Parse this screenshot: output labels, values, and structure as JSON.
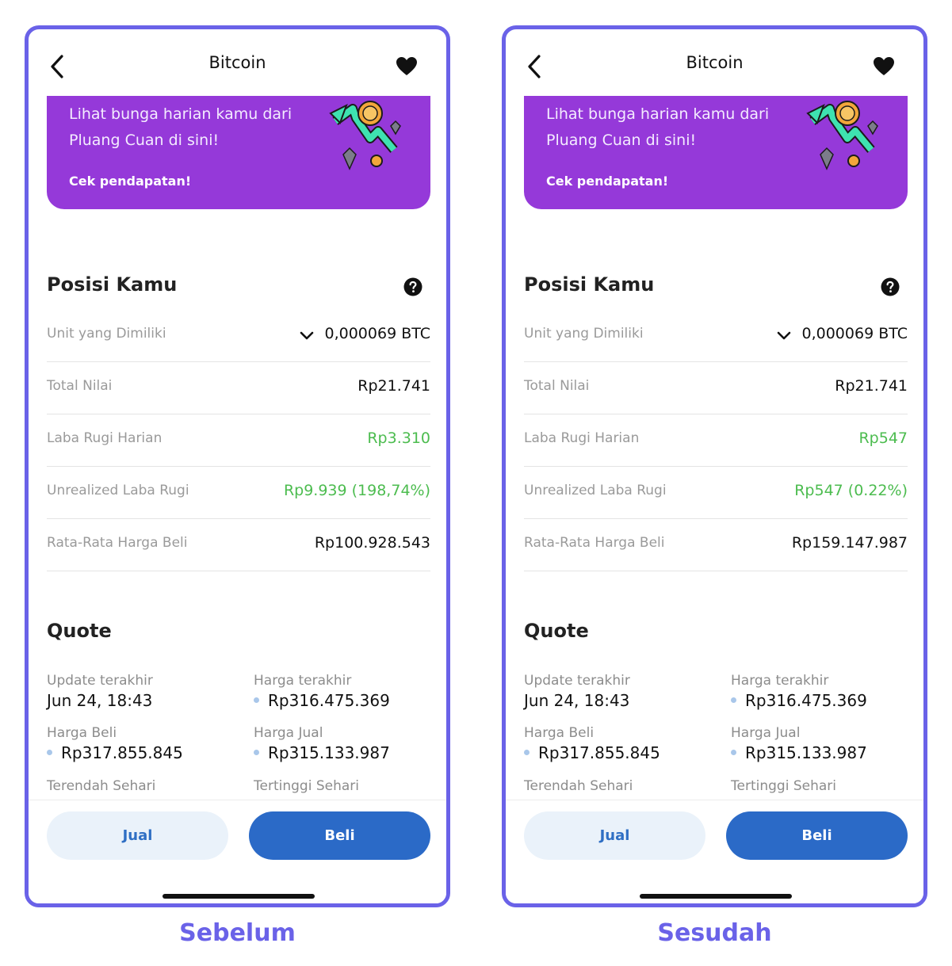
{
  "colors": {
    "frame": "#6a62e8",
    "banner": "#9539d9",
    "positive": "#4cbc4f",
    "primary": "#2b6ac7"
  },
  "panels": [
    {
      "caption": "Sebelum",
      "header": {
        "title": "Bitcoin",
        "back_icon": "chevron-left-icon",
        "fav_icon": "heart-icon"
      },
      "banner": {
        "text": "Lihat bunga harian kamu dari Pluang Cuan di sini!",
        "cta": "Cek pendapatan!"
      },
      "position": {
        "title": "Posisi Kamu",
        "rows": [
          {
            "label": "Unit yang Dimiliki",
            "value": "0,000069 BTC"
          },
          {
            "label": "Total Nilai",
            "value": "Rp21.741"
          },
          {
            "label": "Laba Rugi Harian",
            "value": "Rp3.310"
          },
          {
            "label": "Unrealized Laba Rugi",
            "value": "Rp9.939 (198,74%)"
          },
          {
            "label": "Rata-Rata Harga Beli",
            "value": "Rp100.928.543"
          }
        ]
      },
      "quote": {
        "title": "Quote",
        "update_label": "Update terakhir",
        "update_value": "Jun 24, 18:43",
        "last_label": "Harga terakhir",
        "last_value": "Rp316.475.369",
        "buy_label": "Harga Beli",
        "buy_value": "Rp317.855.845",
        "sell_label": "Harga Jual",
        "sell_value": "Rp315.133.987",
        "low_label": "Terendah Sehari",
        "high_label": "Tertinggi Sehari"
      },
      "actions": {
        "sell": "Jual",
        "buy": "Beli"
      }
    },
    {
      "caption": "Sesudah",
      "header": {
        "title": "Bitcoin",
        "back_icon": "chevron-left-icon",
        "fav_icon": "heart-icon"
      },
      "banner": {
        "text": "Lihat bunga harian kamu dari Pluang Cuan di sini!",
        "cta": "Cek pendapatan!"
      },
      "position": {
        "title": "Posisi Kamu",
        "rows": [
          {
            "label": "Unit yang Dimiliki",
            "value": "0,000069 BTC"
          },
          {
            "label": "Total Nilai",
            "value": "Rp21.741"
          },
          {
            "label": "Laba Rugi Harian",
            "value": "Rp547"
          },
          {
            "label": "Unrealized Laba Rugi",
            "value": "Rp547 (0.22%)"
          },
          {
            "label": "Rata-Rata Harga Beli",
            "value": "Rp159.147.987"
          }
        ]
      },
      "quote": {
        "title": "Quote",
        "update_label": "Update terakhir",
        "update_value": "Jun 24, 18:43",
        "last_label": "Harga terakhir",
        "last_value": "Rp316.475.369",
        "buy_label": "Harga Beli",
        "buy_value": "Rp317.855.845",
        "sell_label": "Harga Jual",
        "sell_value": "Rp315.133.987",
        "low_label": "Terendah Sehari",
        "high_label": "Tertinggi Sehari"
      },
      "actions": {
        "sell": "Jual",
        "buy": "Beli"
      }
    }
  ]
}
